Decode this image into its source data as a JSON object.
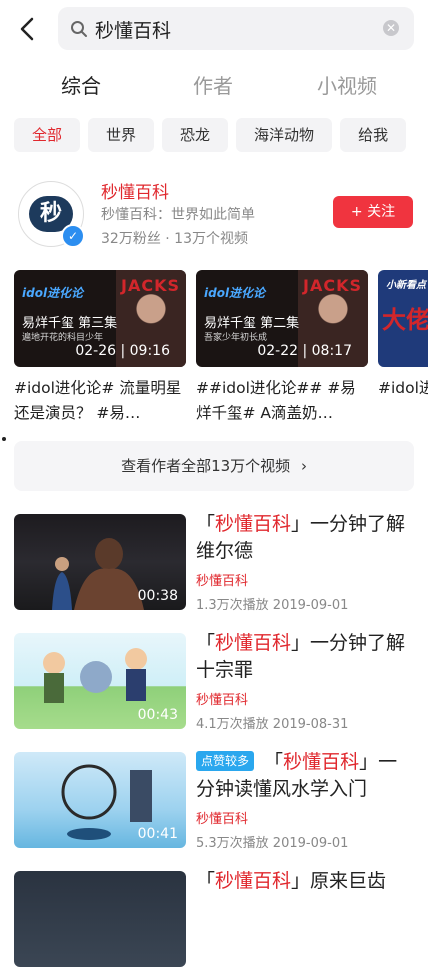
{
  "search": {
    "query": "秒懂百科",
    "clear_icon": "clear-icon"
  },
  "tabs": [
    "综合",
    "作者",
    "小视频"
  ],
  "chips": [
    "全部",
    "世界",
    "恐龙",
    "海洋动物",
    "给我"
  ],
  "author": {
    "name": "秒懂百科",
    "desc": "秒懂百科：世界如此简单",
    "stats": "32万粉丝 · 13万个视频",
    "follow_label": "+ 关注",
    "avatar_mark": "秒"
  },
  "cards": [
    {
      "logo": "idol进化论",
      "overlay_title": "易烊千玺 第三集",
      "overlay_sub": "遍地开花的科目少年",
      "brand": "JACKS",
      "time": "02-26 | 09:16",
      "title": "#idol进化论# 流量明星还是演员？ #易…"
    },
    {
      "logo": "idol进化论",
      "overlay_title": "易烊千玺 第二集",
      "overlay_sub": "吾家少年初长成",
      "brand": "JACKS",
      "time": "02-22 | 08:17",
      "title": "##idol进化论## #易烊千玺# A滴盖奶…"
    },
    {
      "logo": "小新看点",
      "overlay_title": "大佬",
      "overlay_sub": "",
      "brand": "",
      "time": "",
      "title": "#idol进化论# 是可盐"
    }
  ],
  "view_all": "查看作者全部13万个视频",
  "videos": [
    {
      "tag": "",
      "pre": "「",
      "hl": "秒懂百科",
      "post": "」一分钟了解维尔德",
      "author": "秒懂百科",
      "meta": "1.3万次播放  2019-09-01",
      "duration": "00:38"
    },
    {
      "tag": "",
      "pre": "「",
      "hl": "秒懂百科",
      "post": "」一分钟了解十宗罪",
      "author": "秒懂百科",
      "meta": "4.1万次播放  2019-08-31",
      "duration": "00:43"
    },
    {
      "tag": "点赞较多",
      "pre": " 「",
      "hl": "秒懂百科",
      "post": "」一分钟读懂风水学入门",
      "author": "秒懂百科",
      "meta": "5.3万次播放  2019-09-01",
      "duration": "00:41"
    },
    {
      "tag": "",
      "pre": "「",
      "hl": "秒懂百科",
      "post": "」原来巨齿",
      "author": "",
      "meta": "",
      "duration": ""
    }
  ],
  "colors": {
    "accent": "#e0282e",
    "follow_bg": "#f0343f",
    "tag_bg": "#2aa7ee"
  }
}
